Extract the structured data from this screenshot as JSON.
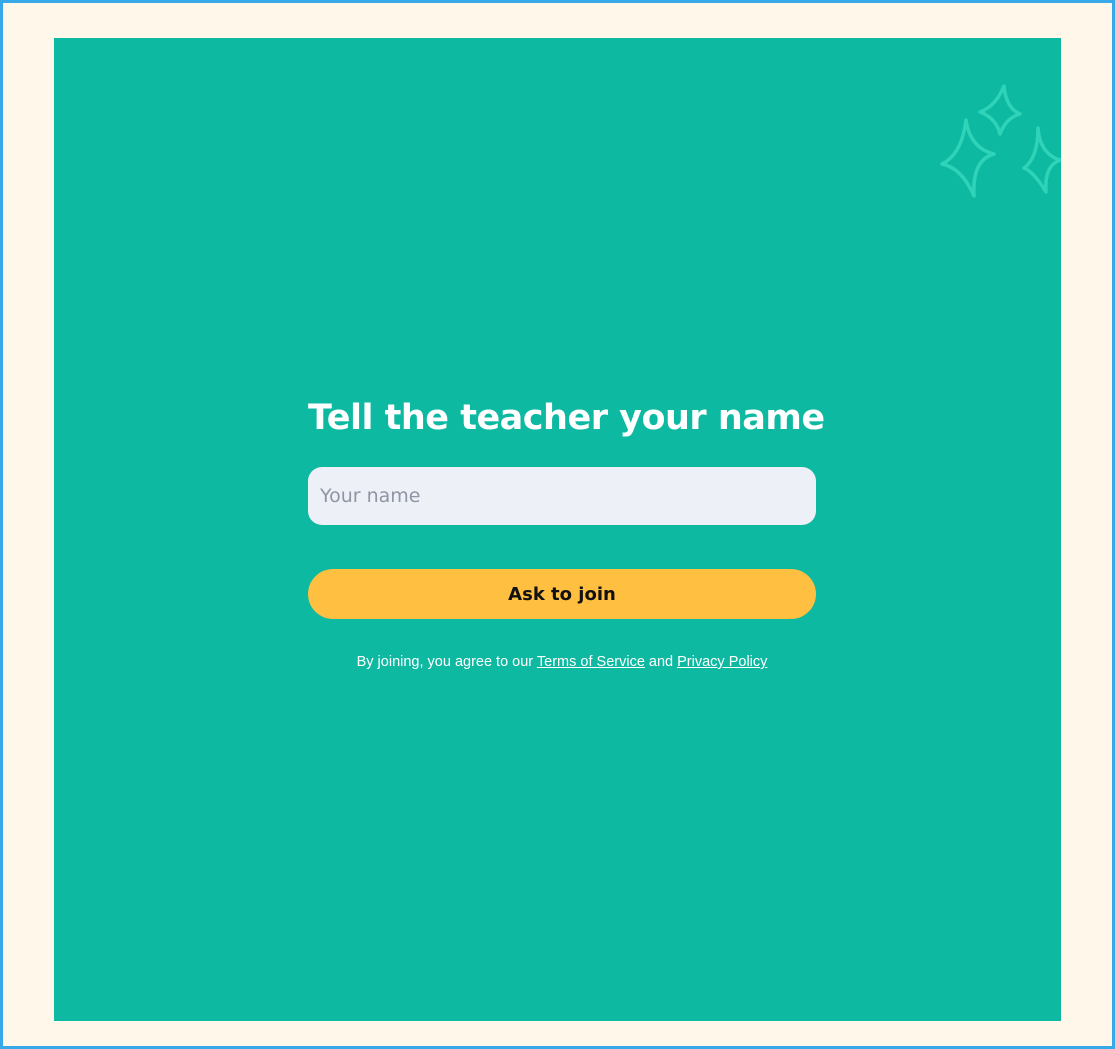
{
  "join_form": {
    "title": "Tell the teacher your name",
    "name_input": {
      "placeholder": "Your name",
      "value": ""
    },
    "submit_label": "Ask to join",
    "legal": {
      "prefix": "By joining, you agree to our ",
      "terms_link": "Terms of Service",
      "conjunction": " and ",
      "privacy_link": "Privacy Policy"
    }
  },
  "colors": {
    "frame_border": "#38a9e8",
    "page_background": "#fff8ea",
    "panel_background": "#0eb9a1",
    "input_background": "#eef0f8",
    "button_background": "#ffbf40",
    "sparkle": "#2fd3b8"
  },
  "decorations": {
    "sparkles_icon": "sparkles-icon"
  }
}
